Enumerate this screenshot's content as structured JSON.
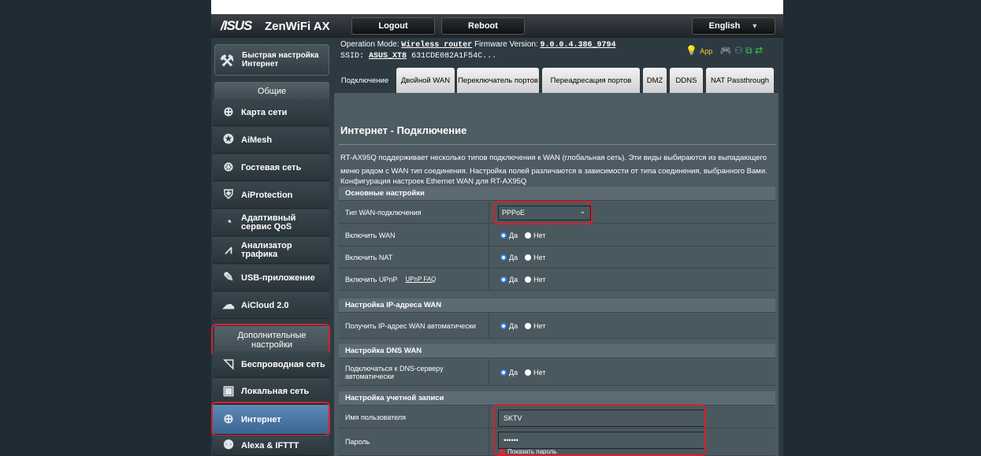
{
  "header": {
    "logo": "/ISUS",
    "product": "ZenWiFi AX",
    "logout": "Logout",
    "reboot": "Reboot",
    "language": "English"
  },
  "info": {
    "op_mode_label": "Operation Mode:",
    "op_mode_value": "Wireless router",
    "firmware_label": "Firmware Version:",
    "firmware_value": "9.0.0.4.386_9794",
    "ssid_label": "SSID:",
    "ssid_1": "ASUS_XT8",
    "ssid_2": "631CDE082A1F54C...",
    "app_label": "App"
  },
  "sidebar": {
    "quick_setup": "Быстрая настройка Интернет",
    "general": "Общие",
    "items": [
      {
        "label": "Карта сети",
        "icon": "globe-network-icon"
      },
      {
        "label": "AiMesh",
        "icon": "mesh-nodes-icon"
      },
      {
        "label": "Гостевая сеть",
        "icon": "guest-network-icon"
      },
      {
        "label": "AiProtection",
        "icon": "lock-shield-icon"
      },
      {
        "label": "Адаптивный сервис QoS",
        "icon": "speedometer-icon"
      },
      {
        "label": "Анализатор трафика",
        "icon": "traffic-wave-icon"
      },
      {
        "label": "USB-приложение",
        "icon": "usb-puzzle-icon"
      },
      {
        "label": "AiCloud 2.0",
        "icon": "cloud-icon"
      }
    ],
    "advanced": "Дополнительные настройки",
    "adv_items": [
      {
        "label": "Беспроводная сеть",
        "icon": "wifi-icon"
      },
      {
        "label": "Локальная сеть",
        "icon": "lan-monitor-icon"
      },
      {
        "label": "Интернет",
        "icon": "internet-globe-icon"
      },
      {
        "label": "Alexa & IFTTT",
        "icon": "alexa-icon"
      }
    ]
  },
  "tabs": [
    "Подключение",
    "Двойной WAN",
    "Переключатель портов",
    "Переадресация портов",
    "DMZ",
    "DDNS",
    "NAT Passthrough"
  ],
  "content": {
    "title": "Интернет - Подключение",
    "description": "RT-AX95Q поддерживает несколько типов подключения к WAN (глобальная сеть). Эти виды выбираются из выпадающего меню рядом с WAN тип соединения. Настройка полей различаются в зависимости от типа соединения, выбранного Вами.",
    "config": "Конфигурация настроек Ethernet WAN для RT-AX95Q",
    "sec_basic": "Основные настройки",
    "wan_type_label": "Тип WAN-подключения",
    "wan_type_value": "PPPoE",
    "enable_wan": "Включить WAN",
    "enable_nat": "Включить NAT",
    "enable_upnp": "Включить UPnP",
    "upnp_faq": "UPnP FAQ",
    "yes": "Да",
    "no": "Нет",
    "sec_ip": "Настройка IP-адреса WAN",
    "auto_ip": "Получить IP-адрес WAN автоматически",
    "sec_dns": "Настройка DNS WAN",
    "auto_dns": "Подключаться к DNS-серверу автоматически",
    "sec_account": "Настройка учетной записи",
    "username_label": "Имя пользователя",
    "username_value": "SKTV",
    "password_label": "Пароль",
    "password_value": "••••••",
    "show_password": "Показать пароль"
  }
}
